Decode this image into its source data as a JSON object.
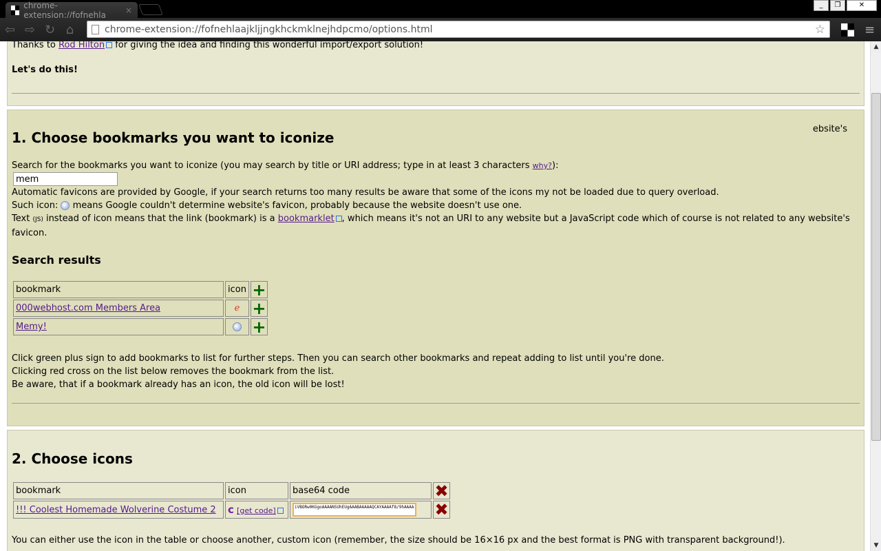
{
  "browser": {
    "tab_title": "chrome-extension://fofnehla",
    "url": "chrome-extension://fofnehlaajkljjngkhckmklnejhdpcmo/options.html"
  },
  "intro": {
    "thanks_prefix": "Thanks to ",
    "thanks_link": "Rod Hilton",
    "thanks_suffix": " for giving the idea and finding this wonderful import/export solution!",
    "lets_go": "Let's do this!"
  },
  "step1": {
    "title": "1. Choose bookmarks you want to iconize",
    "overflow_text": "ebsite's",
    "search_label": "Search for the bookmarks you want to iconize (you may search by title or URI address; type in at least 3 characters ",
    "why_link": "why?",
    "search_label_end": "):",
    "search_value": "mem",
    "info1": "Automatic favicons are provided by Google, if your search returns too many results be aware that some of the icons my not be loaded due to query overload.",
    "info2_prefix": "Such icon: ",
    "info2_suffix": " means Google couldn't determine website's favicon, probably because the website doesn't use one.",
    "info3_prefix": "Text ",
    "info3_js": "(JS)",
    "info3_mid": " instead of icon means that the link (bookmark) is a ",
    "info3_link": "bookmarklet",
    "info3_suffix": ", which means it's not an URI to any website but a JavaScript code which of course is not related to any website's favicon.",
    "results_title": "Search results",
    "table_headers": [
      "bookmark",
      "icon"
    ],
    "results": [
      {
        "title": "000webhost.com Members Area",
        "icon": "000webhost-favicon"
      },
      {
        "title": "Memy!",
        "icon": "globe-icon"
      }
    ],
    "help1": "Click green plus sign to add bookmarks to list for further steps. Then you can search other bookmarks and repeat adding to list until you're done.",
    "help2": "Clicking red cross on the list below removes the bookmark from the list.",
    "help3": "Be aware, that if a bookmark already has an icon, the old icon will be lost!"
  },
  "step2": {
    "title": "2. Choose icons",
    "table_headers": [
      "bookmark",
      "icon",
      "base64 code"
    ],
    "rows": [
      {
        "title": "!!! Coolest Homemade Wolverine Costume 2",
        "get_code": "[get code]",
        "code": "iVBORw0KGgoAAAANSUhEUgAAABAAAAAQCAYAAAAf8/9hAAAA..."
      }
    ],
    "note": "You can either use the icon in the table or choose another, custom icon (remember, the size should be 16×16 px and the best format is PNG with transparent background!)."
  }
}
